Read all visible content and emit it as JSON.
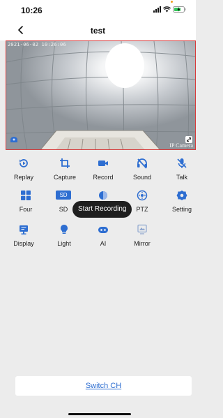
{
  "status_bar": {
    "time": "10:26"
  },
  "nav": {
    "title": "test"
  },
  "video": {
    "timestamp": "2021-06-02 10:26:06",
    "camera_label": "IP Camera"
  },
  "controls": [
    {
      "label": "Replay",
      "icon": "replay-icon"
    },
    {
      "label": "Capture",
      "icon": "crop-icon"
    },
    {
      "label": "Record",
      "icon": "video-camera-icon"
    },
    {
      "label": "Sound",
      "icon": "sound-icon"
    },
    {
      "label": "Talk",
      "icon": "microphone-muted-icon"
    },
    {
      "label": "Four",
      "icon": "grid-four-icon"
    },
    {
      "label": "SD",
      "icon": "sd-badge",
      "badge": "SD"
    },
    {
      "label": "",
      "icon": "brightness-icon"
    },
    {
      "label": "PTZ",
      "icon": "ptz-icon"
    },
    {
      "label": "Setting",
      "icon": "gear-icon"
    },
    {
      "label": "Display",
      "icon": "monitor-icon"
    },
    {
      "label": "Light",
      "icon": "lightbulb-icon"
    },
    {
      "label": "AI",
      "icon": "ai-icon"
    },
    {
      "label": "Mirror",
      "icon": "mirror-icon"
    }
  ],
  "tooltip": {
    "text": "Start Recording"
  },
  "switch_ch": {
    "label": "Switch CH"
  },
  "colors": {
    "accent": "#2e6ed1",
    "video_border": "#d63a3a",
    "tooltip_bg": "#1f1f1f"
  }
}
